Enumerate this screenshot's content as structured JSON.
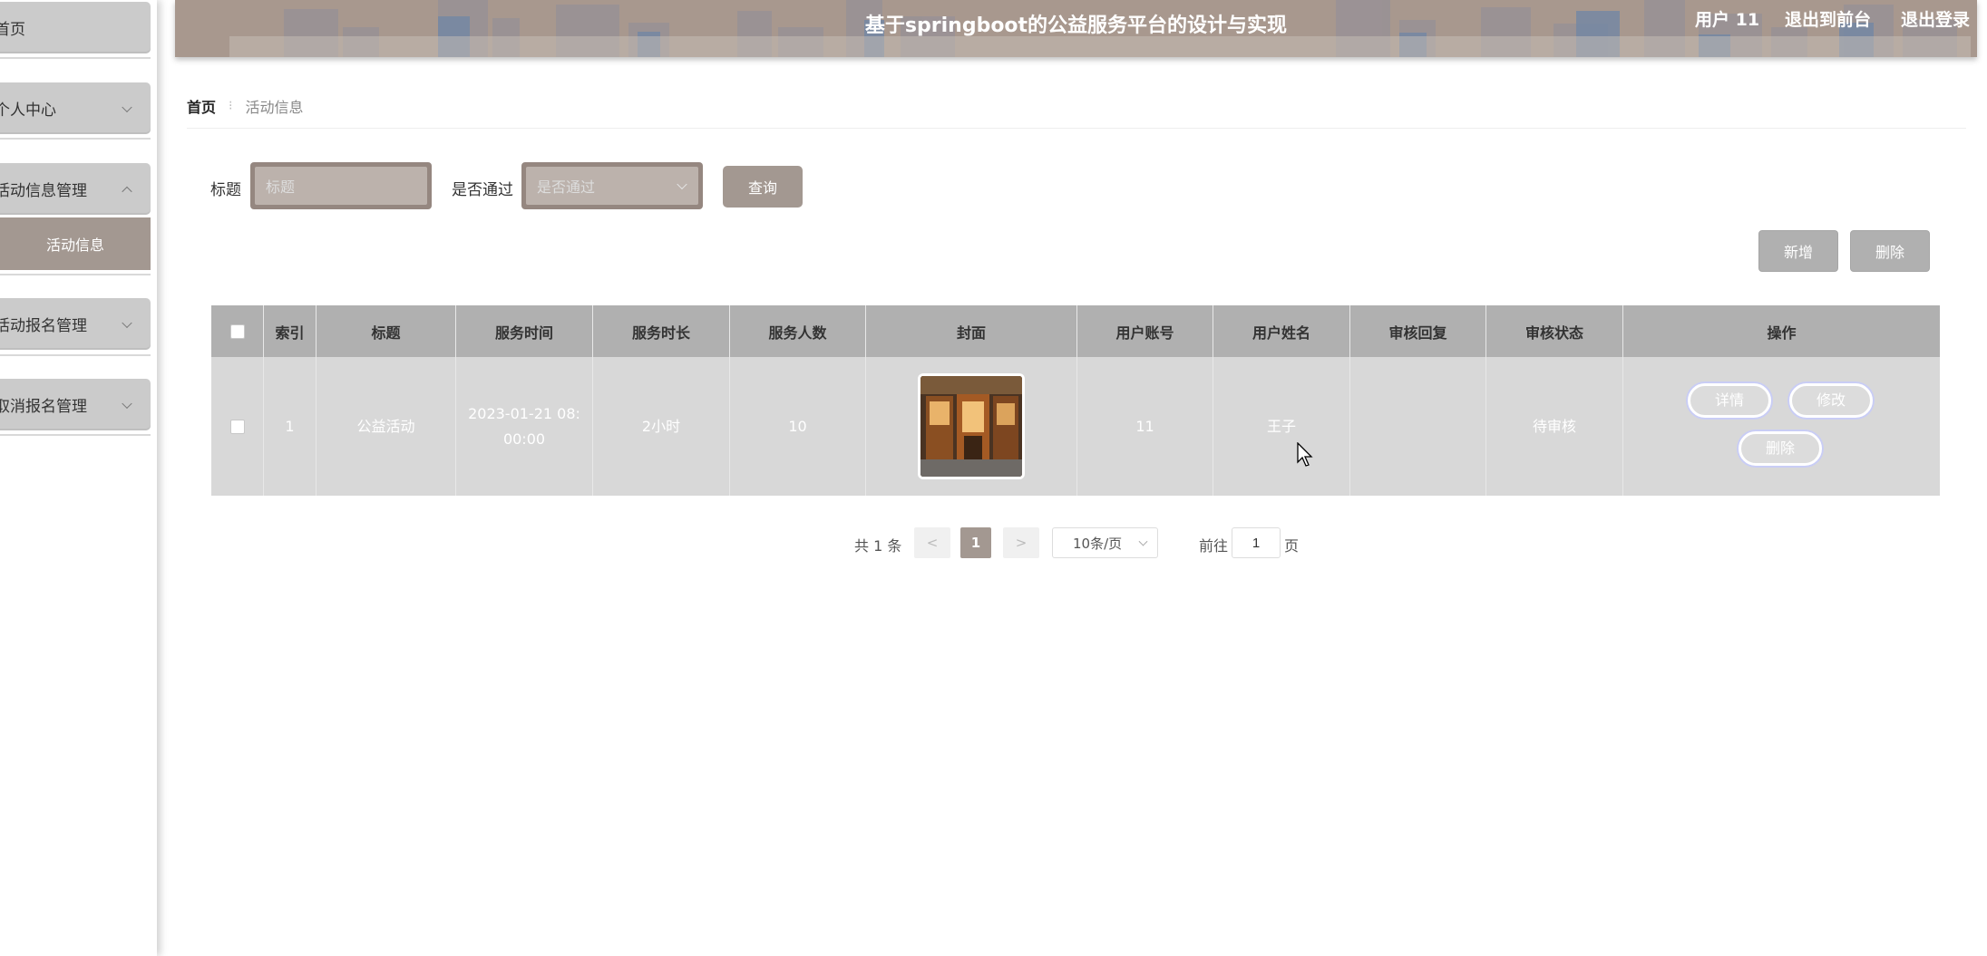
{
  "header": {
    "title": "基于springboot的公益服务平台的设计与实现",
    "user_label": "用户 11",
    "front_link": "退出到前台",
    "logout_link": "退出登录"
  },
  "sidebar": {
    "items": [
      {
        "label": "首页"
      },
      {
        "label": "个人中心"
      },
      {
        "label": "活动信息管理"
      },
      {
        "label": "活动报名管理"
      },
      {
        "label": "取消报名管理"
      }
    ],
    "active_sub": "活动信息"
  },
  "breadcrumb": {
    "home": "首页",
    "separator": "⁝",
    "current": "活动信息"
  },
  "search": {
    "title_label": "标题",
    "title_placeholder": "标题",
    "pass_label": "是否通过",
    "pass_placeholder": "是否通过",
    "query_button": "查询"
  },
  "actions": {
    "add_button": "新增",
    "delete_button": "删除"
  },
  "table": {
    "headers": [
      "索引",
      "标题",
      "服务时间",
      "服务时长",
      "服务人数",
      "封面",
      "用户账号",
      "用户姓名",
      "审核回复",
      "审核状态",
      "操作"
    ],
    "rows": [
      {
        "index": "1",
        "title": "公益活动",
        "service_time": "2023-01-21 08:00:00",
        "duration": "2小时",
        "people": "10",
        "account": "11",
        "name": "王子",
        "reply": "",
        "status": "待审核",
        "ops": {
          "detail": "详情",
          "edit": "修改",
          "delete": "删除"
        }
      }
    ]
  },
  "pagination": {
    "total": "共 1 条",
    "prev": "<",
    "current_page": "1",
    "next": ">",
    "page_size": "10条/页",
    "goto_label": "前往",
    "goto_value": "1",
    "page_unit": "页"
  },
  "colors": {
    "accent": "#a39891",
    "header_bg": "#a8988e",
    "table_head": "#b0b0b0",
    "table_row": "#d8d8d8"
  }
}
